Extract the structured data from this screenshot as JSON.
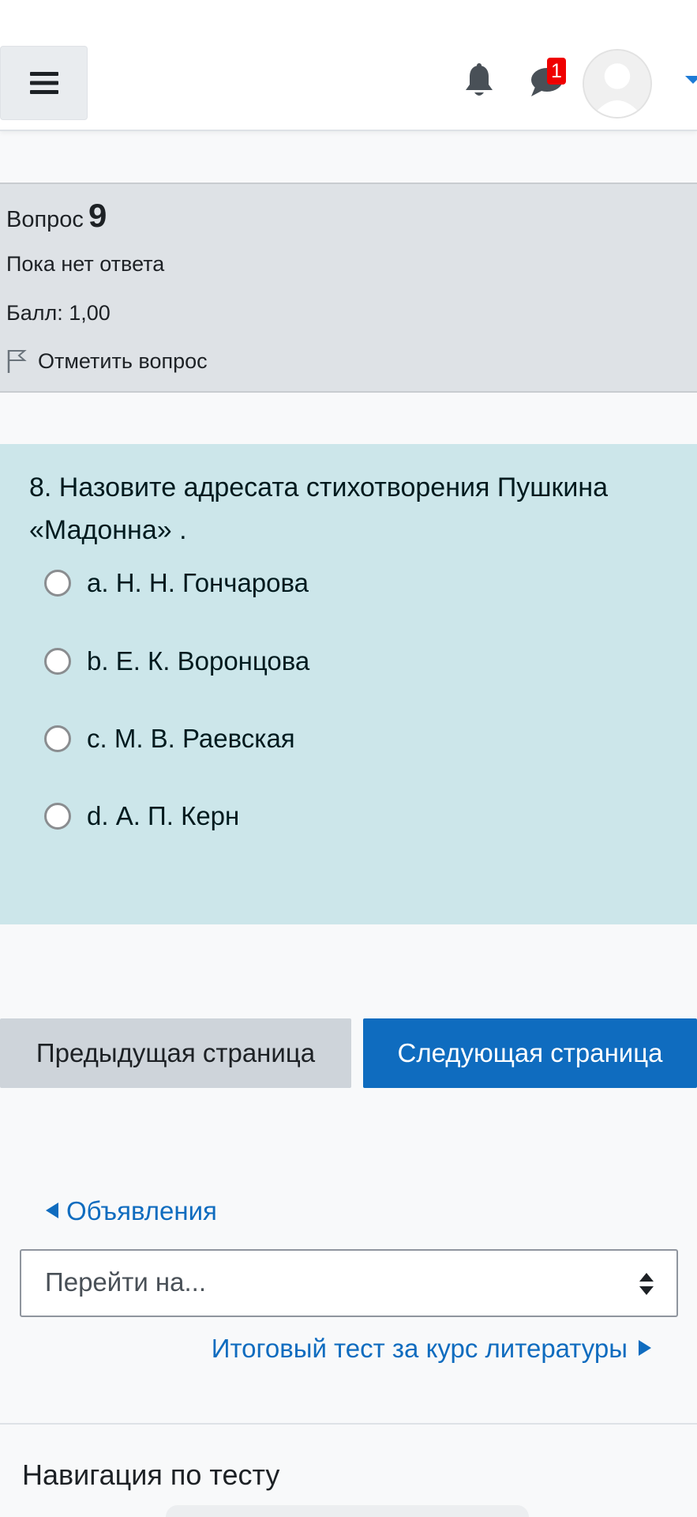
{
  "navbar": {
    "menu_icon": "hamburger-icon",
    "notifications_icon": "bell-icon",
    "messages_icon": "chat-icon",
    "messages_count": "1",
    "avatar_icon": "user-avatar-icon"
  },
  "question_info": {
    "label": "Вопрос",
    "number": "9",
    "state": "Пока нет ответа",
    "grade": "Балл: 1,00",
    "flag_label": "Отметить вопрос"
  },
  "question": {
    "text": "8. Назовите адресата стихотворения Пушкина «Мадонна» .",
    "options": [
      {
        "label": "a. Н. Н. Гончарова"
      },
      {
        "label": "b. Е. К. Воронцова"
      },
      {
        "label": "c. М. В. Раевская"
      },
      {
        "label": "d. А. П. Керн"
      }
    ]
  },
  "buttons": {
    "prev": "Предыдущая страница",
    "next": "Следующая страница"
  },
  "activity_nav": {
    "prev_link": "Объявления",
    "jump_placeholder": "Перейти на...",
    "next_link": "Итоговый тест за курс литературы"
  },
  "quiz_navigation": {
    "title": "Навигация по тесту"
  },
  "colors": {
    "accent": "#0f6cbf",
    "question_bg": "#cce6ea",
    "info_bg": "#dee2e6",
    "badge": "#ef0000"
  }
}
